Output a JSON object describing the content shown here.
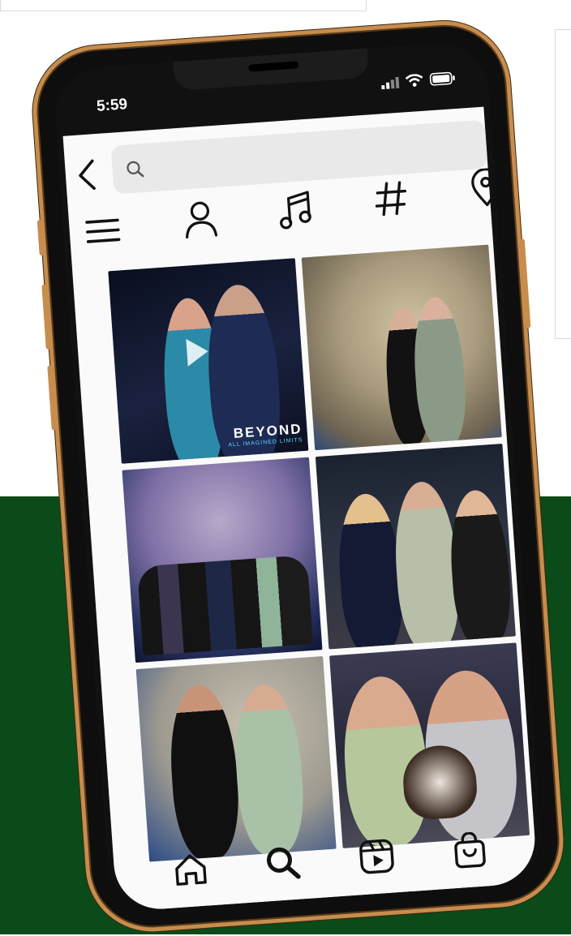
{
  "status": {
    "time": "5:59"
  },
  "search": {
    "placeholder": "",
    "value": ""
  },
  "tabs": [
    {
      "icon": "menu-icon"
    },
    {
      "icon": "account-icon"
    },
    {
      "icon": "audio-icon"
    },
    {
      "icon": "hashtag-icon"
    },
    {
      "icon": "location-pin-icon"
    }
  ],
  "grid": {
    "tiles": [
      {
        "kind": "video",
        "watermark": "BEYOND",
        "watermark_sub": "ALL IMAGINED LIMITS"
      },
      {
        "kind": "photo"
      },
      {
        "kind": "photo"
      },
      {
        "kind": "photo"
      },
      {
        "kind": "photo"
      },
      {
        "kind": "photo"
      }
    ]
  },
  "bottom_nav": [
    {
      "icon": "home-icon"
    },
    {
      "icon": "search-icon",
      "active": true
    },
    {
      "icon": "reels-icon"
    },
    {
      "icon": "shop-icon"
    },
    {
      "icon": "profile-icon"
    }
  ],
  "colors": {
    "phone_frame": "#c78d4d",
    "background_green": "#0b4a19",
    "search_bg": "#e9e9e9",
    "app_bg": "#fafafa"
  }
}
